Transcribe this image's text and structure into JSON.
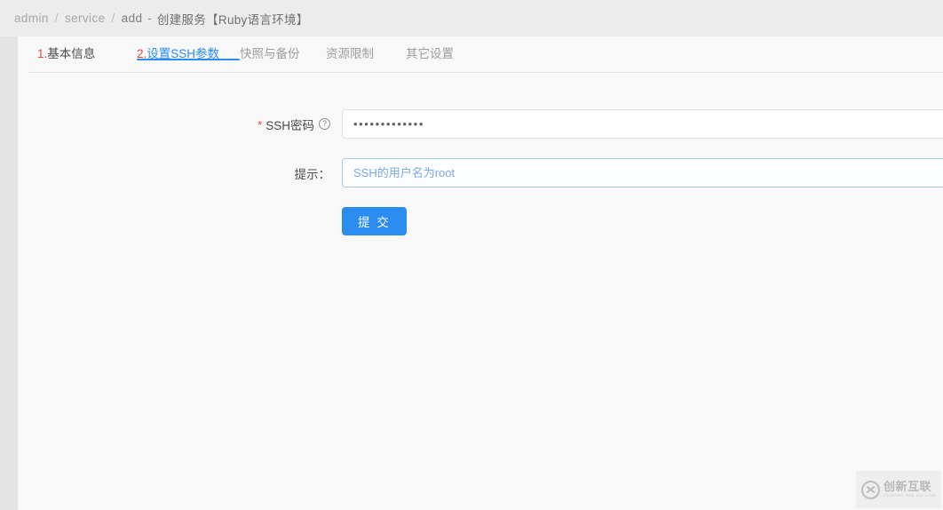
{
  "breadcrumb": {
    "items": [
      {
        "label": "admin",
        "current": false
      },
      {
        "label": "service",
        "current": false
      },
      {
        "label": "add",
        "current": true
      }
    ],
    "separator": "/",
    "dash": "-",
    "title": "创建服务【Ruby语言环境】"
  },
  "tabs": [
    {
      "num": "1.",
      "label": "基本信息",
      "active": false
    },
    {
      "num": "2.",
      "label": "设置SSH参数",
      "active": true
    },
    {
      "num": "",
      "label": "快照与备份",
      "active": false
    },
    {
      "num": "",
      "label": "资源限制",
      "active": false
    },
    {
      "num": "",
      "label": "其它设置",
      "active": false
    }
  ],
  "form": {
    "password_field": {
      "label": "SSH密码",
      "required_mark": "*",
      "help_icon": "question-circle-icon",
      "help_glyph": "?",
      "value": "•••••••••••••",
      "placeholder": ""
    },
    "hint_field": {
      "label": "提示：",
      "value": "",
      "placeholder": "SSH的用户名为root"
    },
    "submit_label": "提 交"
  },
  "watermark": {
    "cn": "创新互联",
    "en": "CHUANG XIN HU LIAN",
    "logo_icon": "chuangxin-logo-icon"
  },
  "colors": {
    "accent": "#2b8cf0",
    "required": "#e4483c",
    "panel_bg": "#f8f8f8",
    "page_bg": "#e4e4e4",
    "header_bg": "#ececec"
  }
}
